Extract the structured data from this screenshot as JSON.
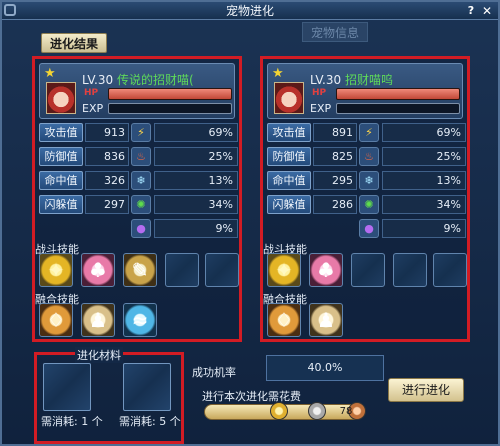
{
  "window": {
    "title": "宠物进化",
    "help": "?",
    "close": "✕"
  },
  "tabs": [
    {
      "label": "进化结果"
    },
    {
      "label": "宠物信息"
    }
  ],
  "pets": [
    {
      "level": "LV.30",
      "name": "传说的招财喵(",
      "hp_label": "HP",
      "exp_label": "EXP",
      "stats": [
        {
          "label": "攻击值",
          "value": "913",
          "icon": "lightning-icon",
          "pct": "69%"
        },
        {
          "label": "防御值",
          "value": "836",
          "icon": "fire-icon",
          "pct": "25%"
        },
        {
          "label": "命中值",
          "value": "326",
          "icon": "ice-icon",
          "pct": "13%"
        },
        {
          "label": "闪躲值",
          "value": "297",
          "icon": "nature-icon",
          "pct": "34%"
        },
        {
          "label": "",
          "value": "",
          "icon": "poison-icon",
          "pct": "9%"
        }
      ],
      "battle_skills_label": "战斗技能",
      "fusion_skills_label": "融合技能"
    },
    {
      "level": "LV.30",
      "name": "招财喵呜",
      "hp_label": "HP",
      "exp_label": "EXP",
      "stats": [
        {
          "label": "攻击值",
          "value": "891",
          "icon": "lightning-icon",
          "pct": "69%"
        },
        {
          "label": "防御值",
          "value": "825",
          "icon": "fire-icon",
          "pct": "25%"
        },
        {
          "label": "命中值",
          "value": "295",
          "icon": "ice-icon",
          "pct": "13%"
        },
        {
          "label": "闪躲值",
          "value": "286",
          "icon": "nature-icon",
          "pct": "34%"
        },
        {
          "label": "",
          "value": "",
          "icon": "poison-icon",
          "pct": "9%"
        }
      ],
      "battle_skills_label": "战斗技能",
      "fusion_skills_label": "融合技能"
    }
  ],
  "materials": {
    "title": "进化材料",
    "need1": "需消耗: 1 个",
    "need2": "需消耗: 5 个"
  },
  "success": {
    "label": "成功机率",
    "value": "40.0%"
  },
  "cost": {
    "label": "进行本次进化需花费",
    "amount": "78"
  },
  "evolve_button": "进行进化",
  "colors": {
    "accent_red": "#d21c24",
    "pet_name_green": "#5ed95a"
  }
}
